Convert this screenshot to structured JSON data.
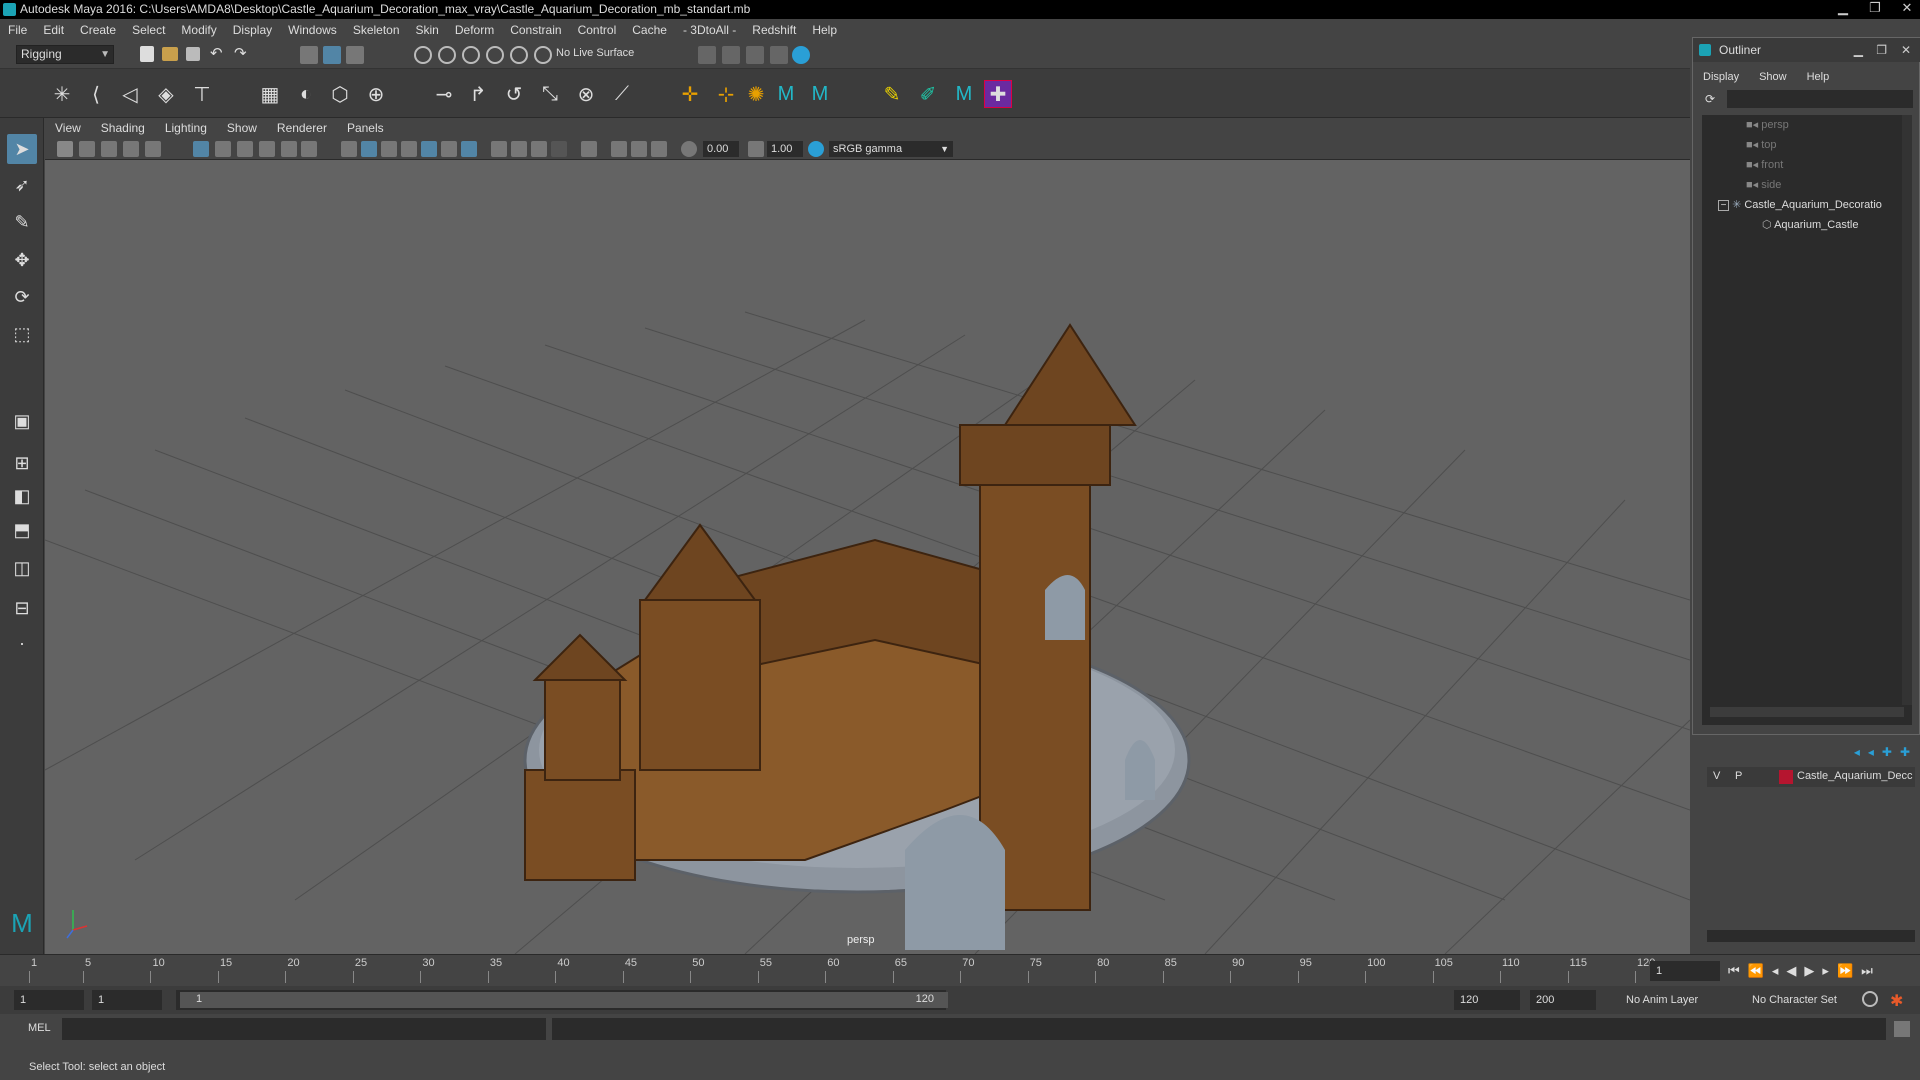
{
  "window": {
    "title": "Autodesk Maya 2016: C:\\Users\\AMDA8\\Desktop\\Castle_Aquarium_Decoration_max_vray\\Castle_Aquarium_Decoration_mb_standart.mb"
  },
  "menubar": [
    "File",
    "Edit",
    "Create",
    "Select",
    "Modify",
    "Display",
    "Windows",
    "Skeleton",
    "Skin",
    "Deform",
    "Constrain",
    "Control",
    "Cache",
    "- 3DtoAll -",
    "Redshift",
    "Help"
  ],
  "shelf": {
    "mode": "Rigging",
    "live_surface": "No Live Surface"
  },
  "viewport": {
    "menu": [
      "View",
      "Shading",
      "Lighting",
      "Show",
      "Renderer",
      "Panels"
    ],
    "exposure": "0.00",
    "gamma": "1.00",
    "color_space": "sRGB gamma",
    "camera_label": "persp"
  },
  "timeline": {
    "ticks": [
      "1",
      "5",
      "10",
      "15",
      "20",
      "25",
      "30",
      "35",
      "40",
      "45",
      "50",
      "55",
      "60",
      "65",
      "70",
      "75",
      "80",
      "85",
      "90",
      "95",
      "100",
      "105",
      "110",
      "115",
      "120"
    ],
    "current_frame": "1"
  },
  "range": {
    "start": "1",
    "playback_start": "1",
    "slider_start": "1",
    "slider_end": "120",
    "playback_end": "120",
    "end": "200",
    "anim_layer": "No Anim Layer",
    "character_set": "No Character Set"
  },
  "mel": {
    "label": "MEL"
  },
  "status": {
    "text": "Select Tool: select an object"
  },
  "outliner": {
    "title": "Outliner",
    "menu": [
      "Display",
      "Show",
      "Help"
    ],
    "items": [
      "persp",
      "top",
      "front",
      "side",
      "Castle_Aquarium_Decoratio",
      "Aquarium_Castle"
    ]
  },
  "layers": {
    "v": "V",
    "p": "P",
    "name": "Castle_Aquarium_Decc",
    "color": "#b5152f"
  },
  "colors": {
    "accent": "#5285a6",
    "maya_teal": "#1ba3b5"
  }
}
